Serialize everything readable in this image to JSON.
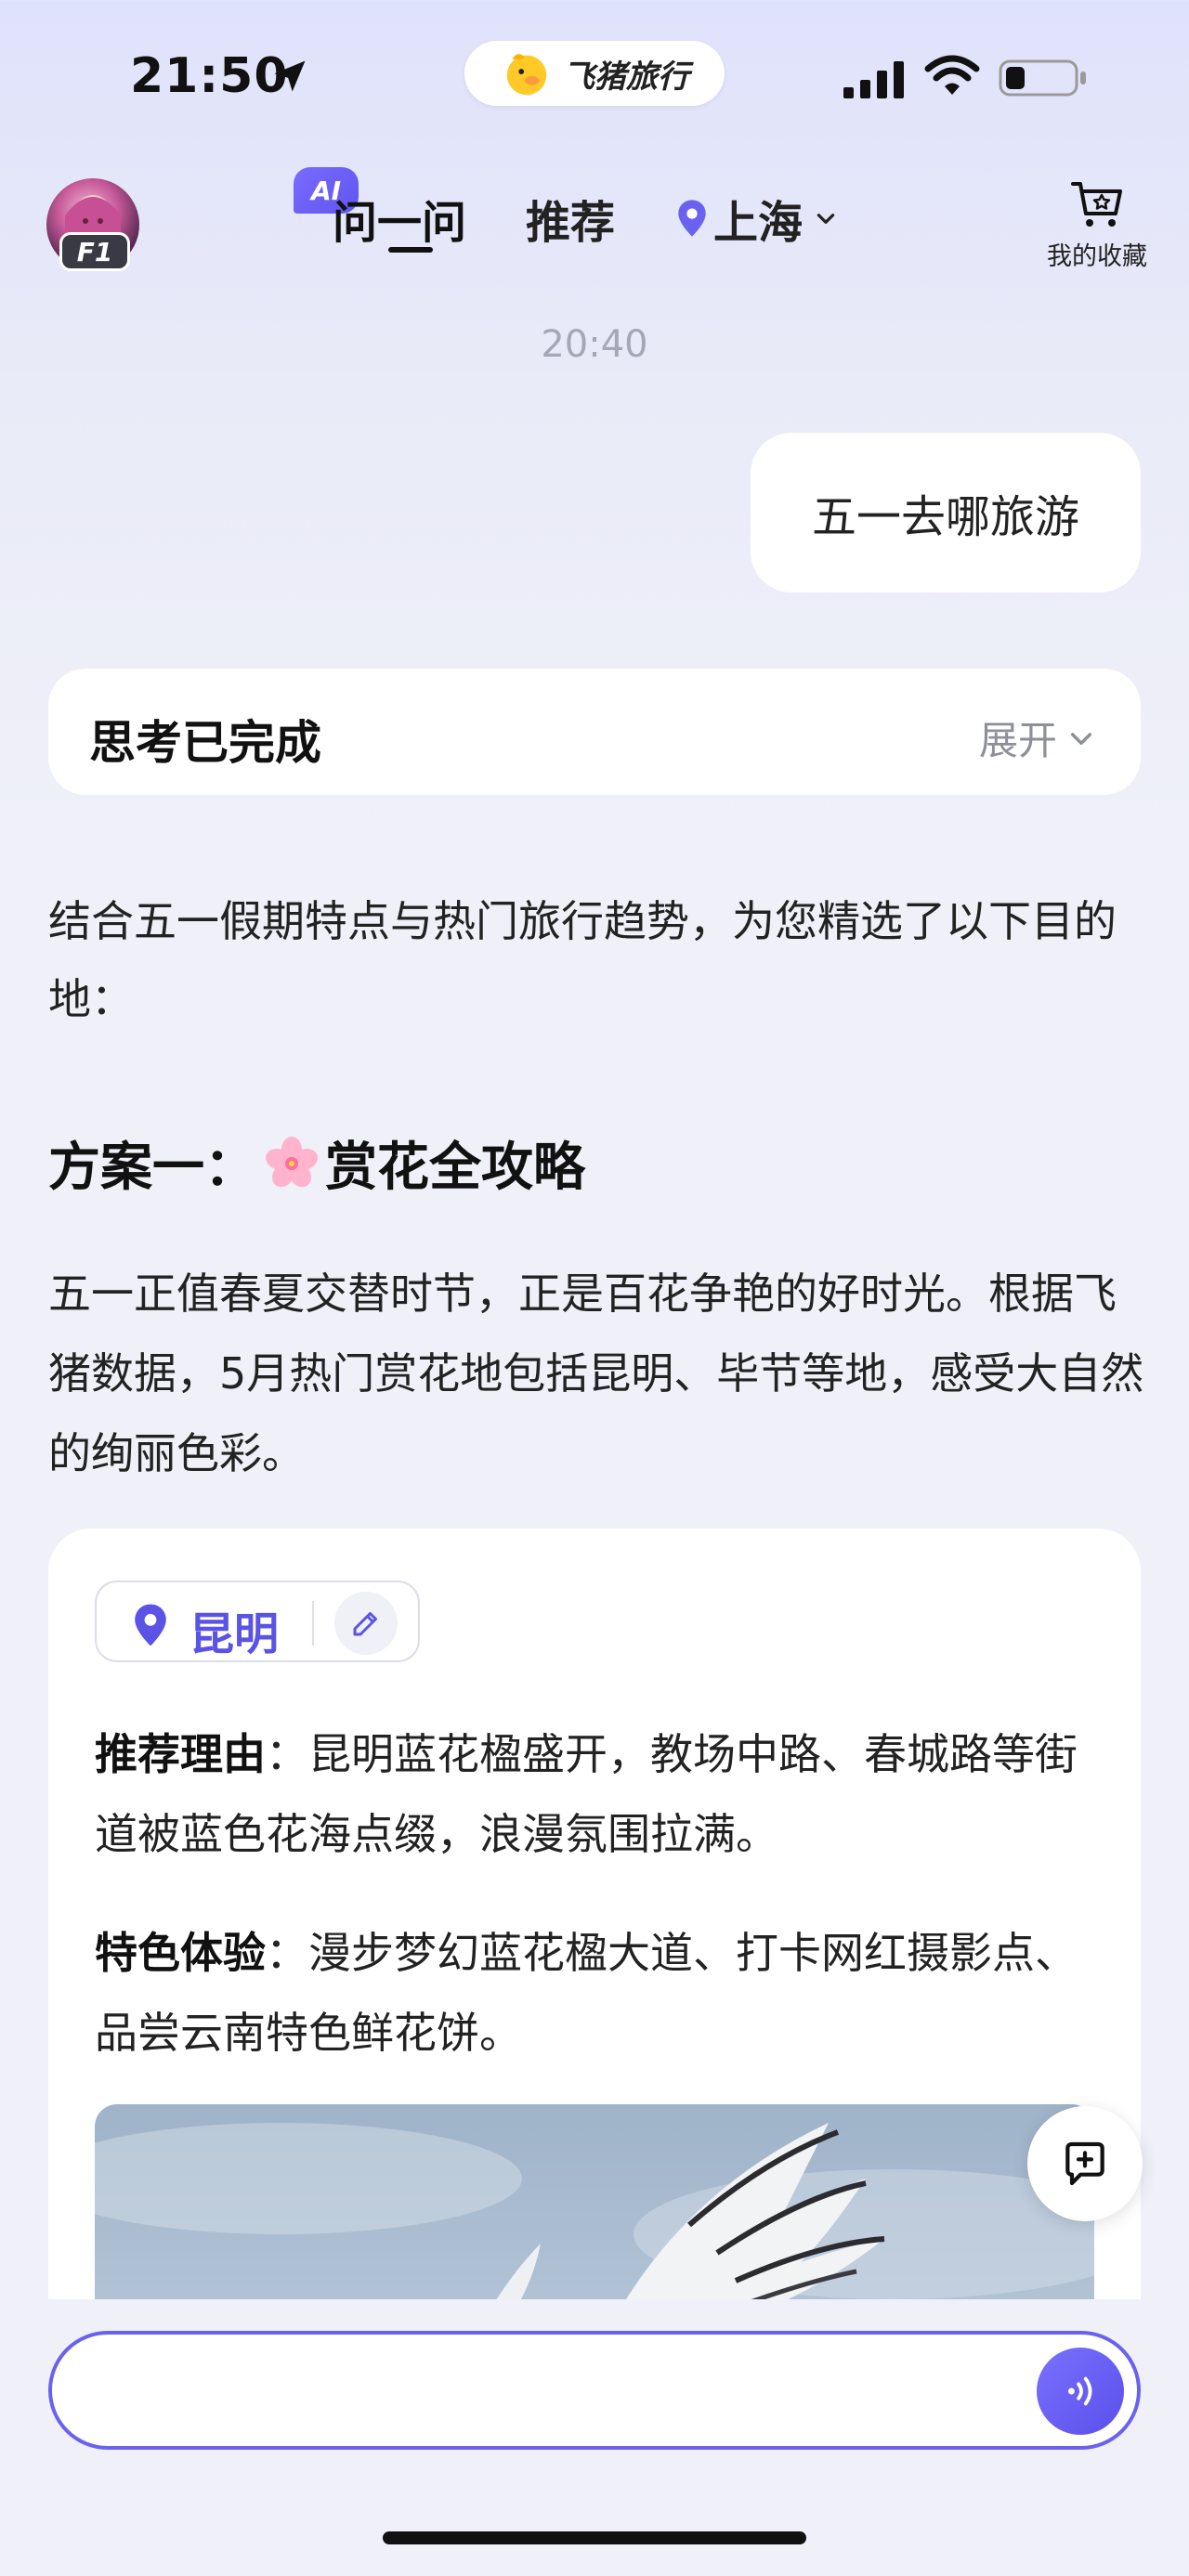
{
  "status_bar": {
    "time": "21:50",
    "app_name": "飞猪旅行"
  },
  "nav": {
    "ai_badge": "AI",
    "tab_ask": "问一问",
    "tab_recommend": "推荐",
    "city": "上海",
    "favorites_label": "我的收藏",
    "avatar_badge": "F1"
  },
  "chat": {
    "timestamp": "20:40",
    "user_message": "五一去哪旅游",
    "thinking_title": "思考已完成",
    "thinking_expand": "展开",
    "intro": "结合五一假期特点与热门旅行趋势，为您精选了以下目的地：",
    "plan_prefix": "方案一：",
    "plan_title": "赏花全攻略",
    "plan_description": "五一正值春夏交替时节，正是百花争艳的好时光。根据飞猪数据，5月热门赏花地包括昆明、毕节等地，感受大自然的绚丽色彩。",
    "destination": {
      "name": "昆明",
      "reason_label": "推荐理由",
      "reason_text": "：昆明蓝花楹盛开，教场中路、春城路等街道被蓝色花海点缀，浪漫氛围拉满。",
      "experience_label": "特色体验",
      "experience_text": "：漫步梦幻蓝花楹大道、打卡网红摄影点、品尝云南特色鲜花饼。"
    }
  },
  "input": {
    "value": "",
    "placeholder": ""
  },
  "icons": {
    "location_arrow": "location-arrow-icon",
    "pin": "map-pin-icon",
    "cart": "shopping-cart-star-icon",
    "edit": "pencil-icon",
    "add_chat": "chat-plus-icon",
    "voice": "voice-wave-icon",
    "flower": "cherry-blossom-emoji"
  },
  "colors": {
    "accent": "#5b53e6",
    "input_border": "#6a62ee",
    "bg_top": "#dfe2fb",
    "bg_bottom": "#f0f1f8"
  }
}
